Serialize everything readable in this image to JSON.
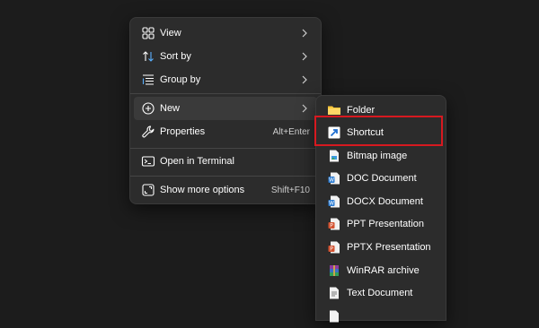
{
  "context_menu": {
    "items": [
      {
        "label": "View",
        "icon": "grid-view-icon",
        "has_submenu": true
      },
      {
        "label": "Sort by",
        "icon": "sort-arrows-icon",
        "has_submenu": true
      },
      {
        "label": "Group by",
        "icon": "group-list-icon",
        "has_submenu": true
      },
      {
        "label": "New",
        "icon": "plus-circle-icon",
        "has_submenu": true,
        "highlighted": true
      },
      {
        "label": "Properties",
        "icon": "wrench-icon",
        "shortcut": "Alt+Enter"
      },
      {
        "label": "Open in Terminal",
        "icon": "terminal-icon"
      },
      {
        "label": "Show more options",
        "icon": "expand-icon",
        "shortcut": "Shift+F10"
      }
    ]
  },
  "new_submenu": {
    "items": [
      {
        "label": "Folder",
        "icon": "folder-icon"
      },
      {
        "label": "Shortcut",
        "icon": "shortcut-arrow-icon",
        "outlined": true
      },
      {
        "label": "Bitmap image",
        "icon": "bitmap-file-icon"
      },
      {
        "label": "DOC Document",
        "icon": "doc-file-icon"
      },
      {
        "label": "DOCX Document",
        "icon": "docx-file-icon"
      },
      {
        "label": "PPT Presentation",
        "icon": "ppt-file-icon"
      },
      {
        "label": "PPTX Presentation",
        "icon": "pptx-file-icon"
      },
      {
        "label": "WinRAR archive",
        "icon": "winrar-archive-icon"
      },
      {
        "label": "Text Document",
        "icon": "text-file-icon"
      }
    ]
  },
  "colors": {
    "menu_bg": "#2c2c2c",
    "hover_bg": "#3a3a3a",
    "highlight_outline": "#d71920",
    "desktop_bg": "#1c1c1c",
    "folder_yellow": "#f8c63a",
    "word_blue": "#2b7cd3",
    "ppt_orange": "#d35230"
  }
}
